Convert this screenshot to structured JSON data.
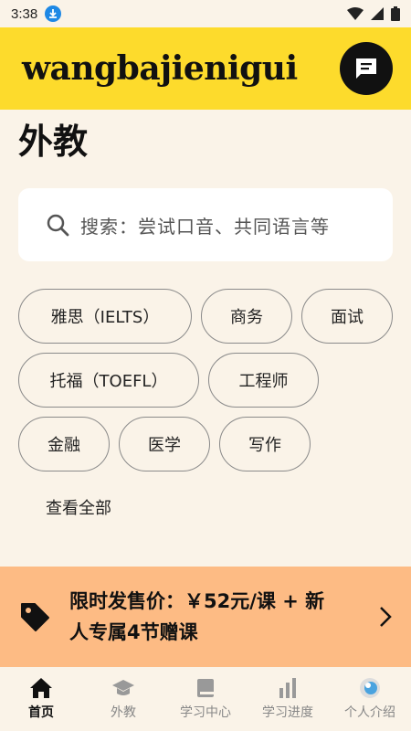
{
  "status": {
    "time": "3:38",
    "download_icon": "download-icon",
    "wifi_icon": "wifi-icon",
    "signal_icon": "signal-icon",
    "battery_icon": "battery-icon"
  },
  "header": {
    "brand": "wangbajienigui",
    "chat_icon": "chat-icon"
  },
  "page_title": "外教",
  "search": {
    "placeholder": "搜索：尝试口音、共同语言等",
    "icon": "search-icon"
  },
  "tags": [
    "雅思（IELTS）",
    "商务",
    "面试",
    "托福（TOEFL）",
    "工程师",
    "金融",
    "医学",
    "写作"
  ],
  "view_all": "查看全部",
  "promo": {
    "text": "限时发售价：￥52元/课 + 新人专属4节赠课",
    "icon": "price-tag-icon",
    "arrow": "chevron-right-icon"
  },
  "tabs": [
    {
      "label": "首页",
      "icon": "home-icon",
      "active": true
    },
    {
      "label": "外教",
      "icon": "graduation-cap-icon",
      "active": false
    },
    {
      "label": "学习中心",
      "icon": "book-icon",
      "active": false
    },
    {
      "label": "学习进度",
      "icon": "bar-chart-icon",
      "active": false
    },
    {
      "label": "个人介绍",
      "icon": "avatar-icon",
      "active": false
    }
  ],
  "colors": {
    "header": "#fddb2c",
    "background": "#faf3e8",
    "promo": "#fdbb84",
    "download_badge": "#1e88e5"
  }
}
